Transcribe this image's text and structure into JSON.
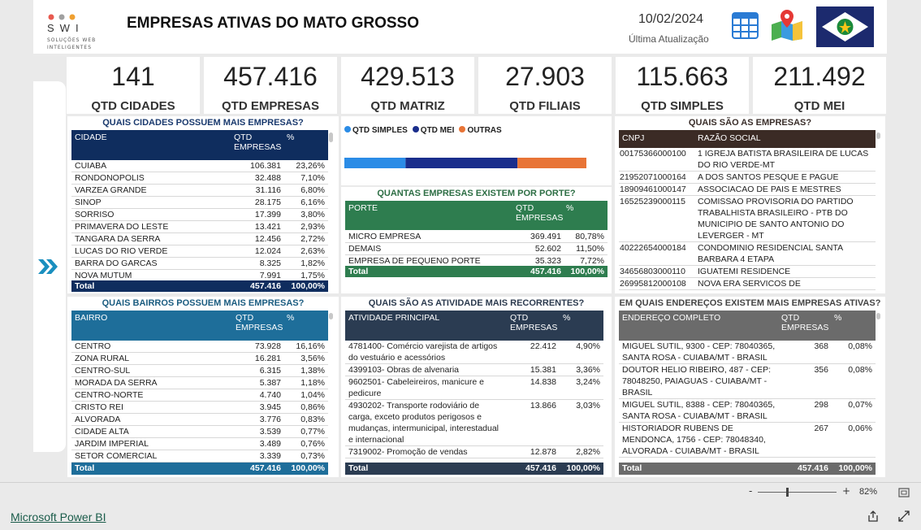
{
  "header": {
    "title": "EMPRESAS ATIVAS DO MATO GROSSO",
    "date": "10/02/2024",
    "update_label": "Última Atualização",
    "logo_text": "SWI",
    "logo_sub1": "SOLUÇÕES WEB",
    "logo_sub2": "INTELIGENTES"
  },
  "kpis": [
    {
      "value": "141",
      "label": "QTD CIDADES"
    },
    {
      "value": "457.416",
      "label": "QTD EMPRESAS"
    },
    {
      "value": "429.513",
      "label": "QTD MATRIZ"
    },
    {
      "value": "27.903",
      "label": "QTD FILIAIS"
    },
    {
      "value": "115.663",
      "label": "QTD SIMPLES"
    },
    {
      "value": "211.492",
      "label": "QTD MEI"
    }
  ],
  "cidades": {
    "title": "QUAIS CIDADES POSSUEM MAIS EMPRESAS?",
    "col1": "CIDADE",
    "col2": "QTD EMPRESAS",
    "col3": "%",
    "rows": [
      [
        "CUIABA",
        "106.381",
        "23,26%"
      ],
      [
        "RONDONOPOLIS",
        "32.488",
        "7,10%"
      ],
      [
        "VARZEA GRANDE",
        "31.116",
        "6,80%"
      ],
      [
        "SINOP",
        "28.175",
        "6,16%"
      ],
      [
        "SORRISO",
        "17.399",
        "3,80%"
      ],
      [
        "PRIMAVERA DO LESTE",
        "13.421",
        "2,93%"
      ],
      [
        "TANGARA DA SERRA",
        "12.456",
        "2,72%"
      ],
      [
        "LUCAS DO RIO VERDE",
        "12.024",
        "2,63%"
      ],
      [
        "BARRA DO GARCAS",
        "8.325",
        "1,82%"
      ],
      [
        "NOVA MUTUM",
        "7.991",
        "1,75%"
      ]
    ],
    "total": [
      "Total",
      "457.416",
      "100,00%"
    ]
  },
  "legend": [
    {
      "label": "QTD SIMPLES",
      "color": "#2b8ce6"
    },
    {
      "label": "QTD MEI",
      "color": "#1a2e8c"
    },
    {
      "label": "OUTRAS",
      "color": "#e87436"
    }
  ],
  "stacked": {
    "simples": 115663,
    "mei": 211492,
    "outras": 130261
  },
  "porte": {
    "title": "QUANTAS EMPRESAS EXISTEM POR PORTE?",
    "col1": "PORTE",
    "col2": "QTD EMPRESAS",
    "col3": "%",
    "rows": [
      [
        "MICRO EMPRESA",
        "369.491",
        "80,78%"
      ],
      [
        "DEMAIS",
        "52.602",
        "11,50%"
      ],
      [
        "EMPRESA DE PEQUENO PORTE",
        "35.323",
        "7,72%"
      ]
    ],
    "total": [
      "Total",
      "457.416",
      "100,00%"
    ]
  },
  "empresas": {
    "title": "QUAIS SÃO AS EMPRESAS?",
    "col1": "CNPJ",
    "col2": "RAZÃO SOCIAL",
    "rows": [
      [
        "00175366000100",
        "1 IGREJA BATISTA BRASILEIRA DE LUCAS DO RIO VERDE-MT"
      ],
      [
        "21952071000164",
        "A DOS SANTOS PESQUE E PAGUE"
      ],
      [
        "18909461000147",
        "ASSOCIACAO DE PAIS E MESTRES"
      ],
      [
        "16525239000115",
        "COMISSAO PROVISORIA DO PARTIDO TRABALHISTA BRASILEIRO - PTB DO MUNICIPIO DE SANTO ANTONIO DO LEVERGER - MT"
      ],
      [
        "40222654000184",
        "CONDOMINIO RESIDENCIAL SANTA BARBARA 4 ETAPA"
      ],
      [
        "34656803000110",
        "IGUATEMI RESIDENCE"
      ],
      [
        "26995812000108",
        "NOVA ERA SERVICOS DE TERRAPLANAGEM"
      ]
    ]
  },
  "bairros": {
    "title": "QUAIS BAIRROS POSSUEM MAIS EMPRESAS?",
    "col1": "BAIRRO",
    "col2": "QTD EMPRESAS",
    "col3": "%",
    "rows": [
      [
        "CENTRO",
        "73.928",
        "16,16%"
      ],
      [
        "ZONA RURAL",
        "16.281",
        "3,56%"
      ],
      [
        "CENTRO-SUL",
        "6.315",
        "1,38%"
      ],
      [
        "MORADA DA SERRA",
        "5.387",
        "1,18%"
      ],
      [
        "CENTRO-NORTE",
        "4.740",
        "1,04%"
      ],
      [
        "CRISTO REI",
        "3.945",
        "0,86%"
      ],
      [
        "ALVORADA",
        "3.776",
        "0,83%"
      ],
      [
        "CIDADE ALTA",
        "3.539",
        "0,77%"
      ],
      [
        "JARDIM IMPERIAL",
        "3.489",
        "0,76%"
      ],
      [
        "SETOR COMERCIAL",
        "3.339",
        "0,73%"
      ]
    ],
    "total": [
      "Total",
      "457.416",
      "100,00%"
    ]
  },
  "atividades": {
    "title": "QUAIS SÃO AS ATIVIDADE MAIS RECORRENTES?",
    "col1": "ATIVIDADE PRINCIPAL",
    "col2": "QTD EMPRESAS",
    "col3": "%",
    "rows": [
      [
        "4781400- Comércio varejista de artigos do vestuário e acessórios",
        "22.412",
        "4,90%"
      ],
      [
        "4399103- Obras de alvenaria",
        "15.381",
        "3,36%"
      ],
      [
        "9602501- Cabeleireiros, manicure e pedicure",
        "14.838",
        "3,24%"
      ],
      [
        "4930202- Transporte rodoviário de carga, exceto produtos perigosos e mudanças, intermunicipal, interestadual e internacional",
        "13.866",
        "3,03%"
      ],
      [
        "7319002- Promoção de vendas",
        "12.878",
        "2,82%"
      ]
    ],
    "total": [
      "Total",
      "457.416",
      "100,00%"
    ]
  },
  "enderecos": {
    "title": "EM QUAIS ENDEREÇOS EXISTEM MAIS EMPRESAS ATIVAS?",
    "col1": "ENDEREÇO COMPLETO",
    "col2": "QTD EMPRESAS",
    "col3": "%",
    "rows": [
      [
        "MIGUEL SUTIL, 9300 - CEP: 78040365, SANTA ROSA - CUIABA/MT - BRASIL",
        "368",
        "0,08%"
      ],
      [
        "DOUTOR HELIO RIBEIRO, 487 - CEP: 78048250, PAIAGUAS - CUIABA/MT - BRASIL",
        "356",
        "0,08%"
      ],
      [
        "MIGUEL SUTIL, 8388 - CEP: 78040365, SANTA ROSA - CUIABA/MT - BRASIL",
        "298",
        "0,07%"
      ],
      [
        "HISTORIADOR RUBENS DE MENDONCA, 1756 - CEP: 78048340, ALVORADA - CUIABA/MT - BRASIL",
        "267",
        "0,06%"
      ]
    ],
    "total": [
      "Total",
      "457.416",
      "100,00%"
    ]
  },
  "footer": {
    "zoom": "82%",
    "minus": "-",
    "plus": "+",
    "powerbi": "Microsoft Power BI"
  }
}
